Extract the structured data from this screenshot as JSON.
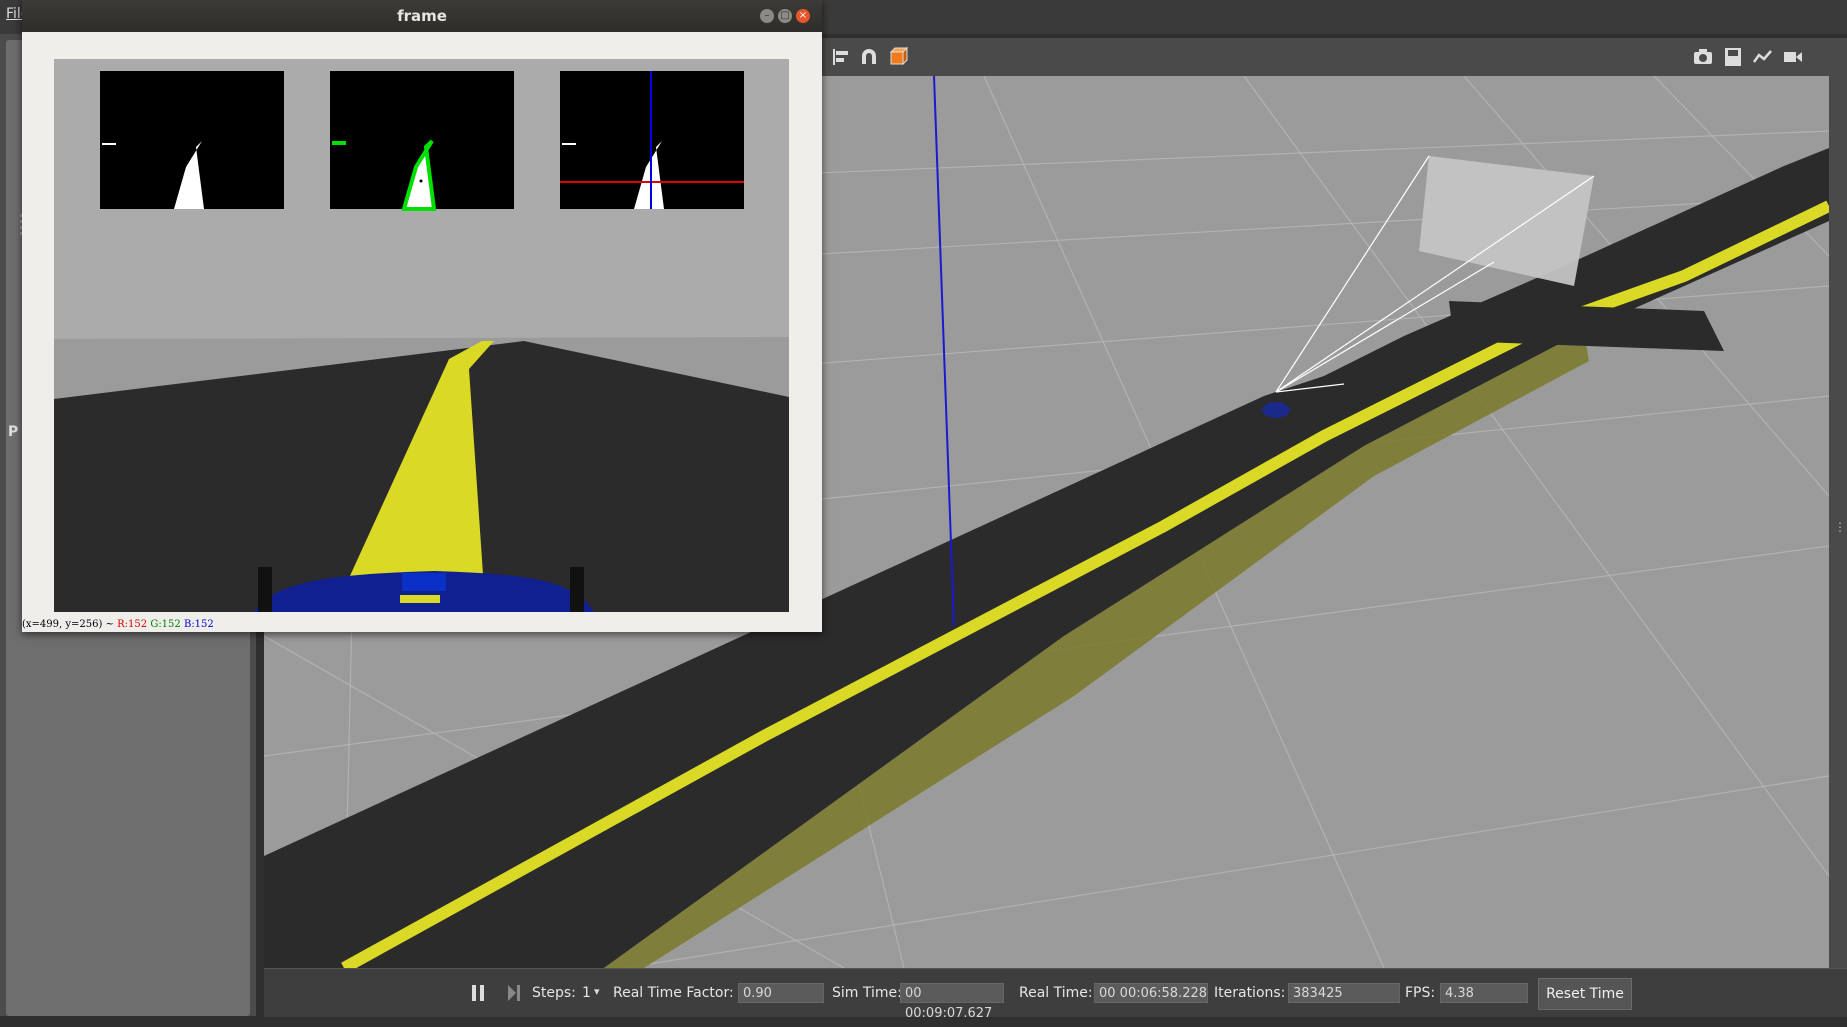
{
  "menu": {
    "file_label": "File"
  },
  "left_panel": {
    "tab_label": "P"
  },
  "frame_window": {
    "title": "frame",
    "status_coords": "(x=499, y=256) ~",
    "status_r": "R:152",
    "status_g": "G:152",
    "status_b": "B:152"
  },
  "bottom_bar": {
    "steps_label": "Steps:",
    "steps_value": "1",
    "real_time_factor_label": "Real Time Factor:",
    "real_time_factor_value": "0.90",
    "sim_time_label": "Sim Time:",
    "sim_time_value": "00 00:09:07.627",
    "real_time_label": "Real Time:",
    "real_time_value": "00 00:06:58.228",
    "iterations_label": "Iterations:",
    "iterations_value": "383425",
    "fps_label": "FPS:",
    "fps_value": "4.38",
    "reset_label": "Reset Time"
  },
  "icons": [
    "align-icon",
    "magnet-icon",
    "box-icon",
    "camera-icon",
    "save-icon",
    "plot-icon",
    "video-icon",
    "pause-icon",
    "step-icon",
    "chevron-down-icon"
  ],
  "colors": {
    "road": "#2b2b2b",
    "lane": "#d9d926",
    "ground": "#9c9c9c",
    "mask_green": "#00e000",
    "crosshair_red": "#e00000",
    "crosshair_blue": "#0000e0"
  }
}
